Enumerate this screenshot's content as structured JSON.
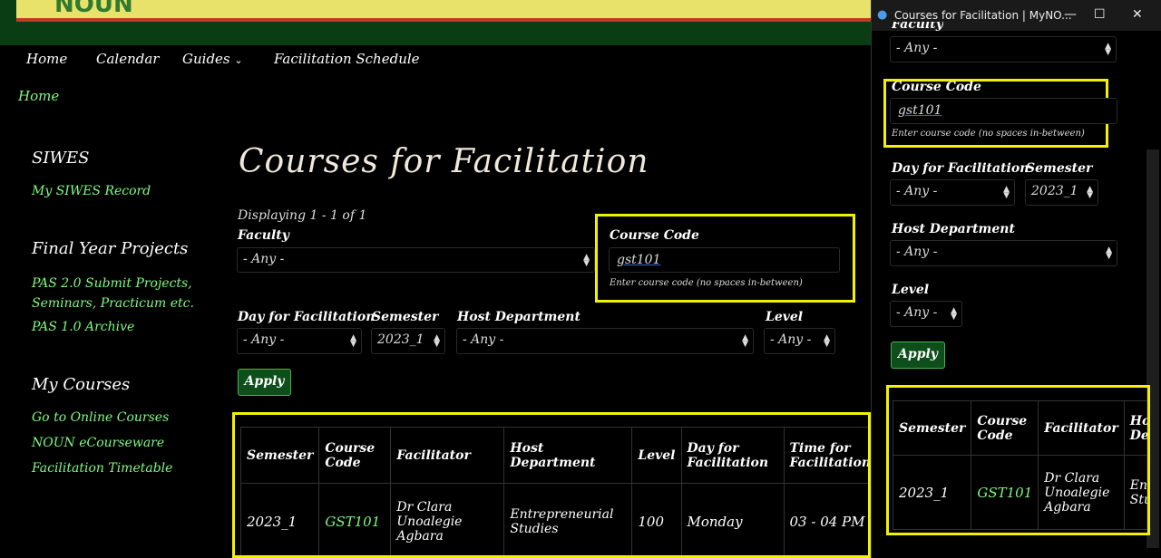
{
  "site": {
    "logo_text": "NOUN"
  },
  "nav": [
    "Home",
    "Calendar",
    "Guides",
    "Facilitation Schedule"
  ],
  "breadcrumb": "Home",
  "sidebar": {
    "siwes": {
      "title": "SIWES",
      "links": [
        "My SIWES Record"
      ]
    },
    "projects": {
      "title": "Final Year Projects",
      "links": [
        "PAS 2.0 Submit Projects, Seminars, Practicum etc.",
        "PAS 1.0 Archive"
      ]
    },
    "courses": {
      "title": "My Courses",
      "links": [
        "Go to Online Courses",
        "NOUN eCourseware",
        "Facilitation Timetable"
      ]
    }
  },
  "main": {
    "title": "Courses for Facilitation",
    "displaying": "Displaying 1 - 1 of 1",
    "filters": {
      "faculty": {
        "label": "Faculty",
        "value": "- Any -"
      },
      "course_code": {
        "label": "Course Code",
        "value": "gst101",
        "help": "Enter course code (no spaces in-between)"
      },
      "day": {
        "label": "Day for Facilitation",
        "value": "- Any -"
      },
      "semester": {
        "label": "Semester",
        "value": "2023_1"
      },
      "host_department": {
        "label": "Host Department",
        "value": "- Any -"
      },
      "level": {
        "label": "Level",
        "value": "- Any -"
      }
    },
    "apply": "Apply",
    "table": {
      "headers": [
        "Semester",
        "Course Code",
        "Facilitator",
        "Host Department",
        "Level",
        "Day for Facilitation",
        "Time for Facilitation"
      ],
      "rows": [
        [
          "2023_1",
          "GST101",
          "Dr Clara Unoalegie Agbara",
          "Entrepreneurial Studies",
          "100",
          "Monday",
          "03 - 04 PM"
        ]
      ]
    }
  },
  "popup": {
    "title": "Courses for Facilitation | MyNO...",
    "partial_label": "Faculty",
    "table_headers": [
      "Semester",
      "Course Code",
      "Facilitator",
      "Host Department"
    ],
    "table_row": [
      "2023_1",
      "GST101",
      "Dr Clara Unoalegie Agbara",
      "Entrepreneurial Studies"
    ]
  },
  "colors": {
    "accent_green": "#7CFC7C",
    "highlight": "#f2f200",
    "button": "#0d4e1a"
  }
}
